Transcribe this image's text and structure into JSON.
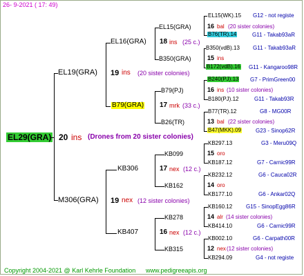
{
  "header": {
    "date_text": "26-  9-2021  ( 17: 49)"
  },
  "footer": {
    "copyright": "Copyright 2004-2021 @ Karl Kehrle Foundation",
    "website": "www.pedigreeapis.org"
  },
  "root": {
    "name": "EL29(GRA)",
    "count": "20",
    "unit": "ins",
    "note": "(Drones from 20 sister colonies)"
  },
  "gen1": [
    {
      "name": "EL19(GRA)",
      "count": "19",
      "unit": "ins",
      "note": "(20 sister colonies)"
    },
    {
      "name": "M306(GRA)",
      "count": "19",
      "unit": "nex",
      "note": "(12 sister colonies)"
    }
  ],
  "gen2": [
    {
      "name": "EL16(GRA)",
      "count": "18",
      "unit": "ins",
      "note": "(25 c.)"
    },
    {
      "name": "B79(GRA)",
      "count": "17",
      "unit": "mrk",
      "note": "(33 c.)"
    },
    {
      "name": "KB306",
      "count": "17",
      "unit": "nex",
      "note": "(12 c.)"
    },
    {
      "name": "KB407",
      "count": "16",
      "unit": "nex",
      "note": "(12 c.)"
    }
  ],
  "gen3": [
    {
      "name": "EL15(GRA)",
      "count": "16",
      "unit": "bal",
      "note": "(20 sister colonies)"
    },
    {
      "name": "B350(GRA)",
      "count": "15",
      "unit": "ins",
      "note": ""
    },
    {
      "name": "B79(PJ)",
      "count": "16",
      "unit": "ins",
      "note": "(10 sister colonies)"
    },
    {
      "name": "B26(TR)",
      "count": "13",
      "unit": "bal",
      "note": "(22 sister colonies)"
    },
    {
      "name": "KB099",
      "count": "15",
      "unit": "oro",
      "note": ""
    },
    {
      "name": "KB162",
      "count": "14",
      "unit": "oro",
      "note": ""
    },
    {
      "name": "KB278",
      "count": "14",
      "unit": "alr",
      "note": "(14 sister colonies)"
    },
    {
      "name": "KB315",
      "count": "12",
      "unit": "nex",
      "note": "(12 sister colonies)"
    }
  ],
  "gen4": [
    {
      "name": "EL15(WK).15",
      "info": "G12 - not registe",
      "highlight": ""
    },
    {
      "name": "B76(TR).14",
      "info": "G11 - Takab93aR",
      "highlight": "#33ccdd"
    },
    {
      "name": "B350(vdB).13",
      "info": "G11 - Takab93aR",
      "highlight": ""
    },
    {
      "name": "B172(vdB).16",
      "info": "G11 - Kangaroo98R",
      "highlight": "#33cc33"
    },
    {
      "name": "B240(PJ).13",
      "info": "G7 - PrimGreen00",
      "highlight": "#33cc33"
    },
    {
      "name": "B180(PJ).12",
      "info": "G11 - Takab93R",
      "highlight": ""
    },
    {
      "name": "B77(TR).12",
      "info": "G8 - MG00R",
      "highlight": ""
    },
    {
      "name": "B47(MKK).09",
      "info": "G23 - Sinop62R",
      "highlight": "#ffff33"
    },
    {
      "name": "KB297.13",
      "info": "G3 - Meru09Q",
      "highlight": ""
    },
    {
      "name": "KB187.12",
      "info": "G7 - Carnic99R",
      "highlight": ""
    },
    {
      "name": "KB232.12",
      "info": "G6 - Cauca02R",
      "highlight": ""
    },
    {
      "name": "KB177.10",
      "info": "G6 - Ankar02Q",
      "highlight": ""
    },
    {
      "name": "KB160.12",
      "info": "G15 - SinopEgg86R",
      "highlight": ""
    },
    {
      "name": "KB414.10",
      "info": "G6 - Carnic99R",
      "highlight": ""
    },
    {
      "name": "KB002.10",
      "info": "G6 - Carpath00R",
      "highlight": ""
    },
    {
      "name": "KB294.09",
      "info": "G4 - not registe",
      "highlight": ""
    }
  ],
  "colors": {
    "count": "#000000",
    "unit": "#cc0000",
    "note": "#8800aa",
    "root_highlight": "#33cc33",
    "b79_highlight": "#ffff00",
    "info": "#0000aa"
  }
}
